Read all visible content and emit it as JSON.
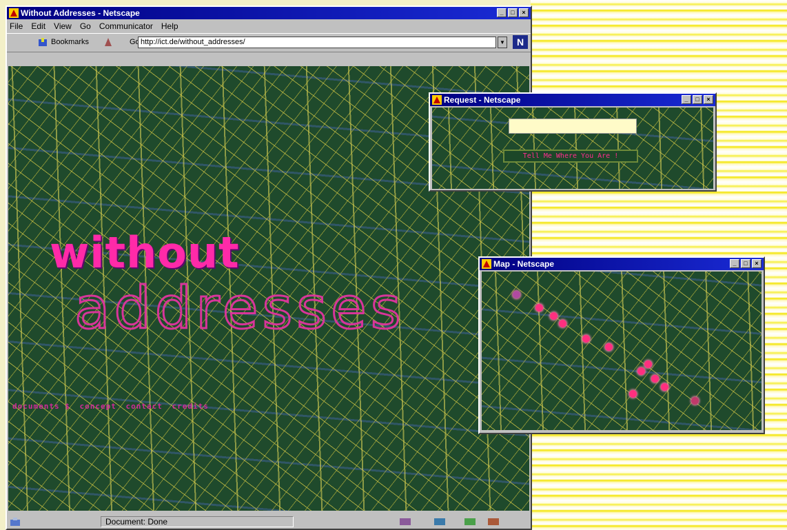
{
  "main_window": {
    "title": "Without Addresses - Netscape",
    "menu": [
      "File",
      "Edit",
      "View",
      "Go",
      "Communicator",
      "Help"
    ],
    "bookmarks_label": "Bookmarks",
    "goto_label": "Go to:",
    "url": "http://ict.de/without_addresses/",
    "headline": "without",
    "subheadline": "addresses",
    "nav_links": [
      "documents $",
      "concept",
      "contact",
      "credits"
    ],
    "status": "Document: Done"
  },
  "request_window": {
    "title": "Request - Netscape",
    "field_value": "",
    "button_label": "Tell Me Where You Are !"
  },
  "map_window": {
    "title": "Map - Netscape"
  },
  "colors": {
    "title_bar": "#000080",
    "accent_pink": "#ff2aa8",
    "map_green": "#1f4a2c"
  }
}
